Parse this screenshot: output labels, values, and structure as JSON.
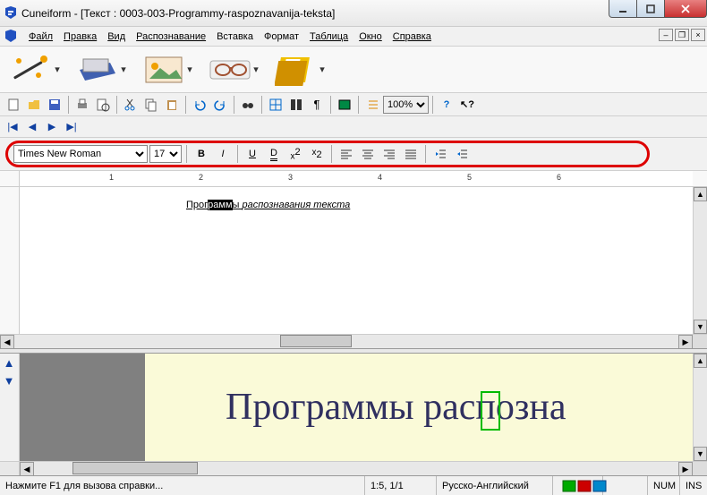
{
  "window": {
    "title": "Cuneiform - [Текст : 0003-003-Programmy-raspoznavanija-teksta]"
  },
  "menu": {
    "file": "Файл",
    "edit": "Правка",
    "view": "Вид",
    "recog": "Распознавание",
    "insert": "Вставка",
    "format": "Формат",
    "table": "Таблица",
    "window": "Окно",
    "help": "Справка"
  },
  "toolbar": {
    "zoom": "100%"
  },
  "format": {
    "font": "Times New Roman",
    "size": "17"
  },
  "ruler": {
    "ticks": [
      "1",
      "2",
      "3",
      "4",
      "5",
      "6"
    ]
  },
  "document": {
    "prefix": "Прог",
    "selected": "рамм",
    "suffix": "ы ",
    "rest": "распознавания текста"
  },
  "preview": {
    "text": "Программы распозна"
  },
  "status": {
    "hint": "Нажмите F1 для вызова справки...",
    "pos": "1:5, 1/1",
    "lang": "Русско-Английский",
    "num": "NUM",
    "ins": "INS"
  }
}
